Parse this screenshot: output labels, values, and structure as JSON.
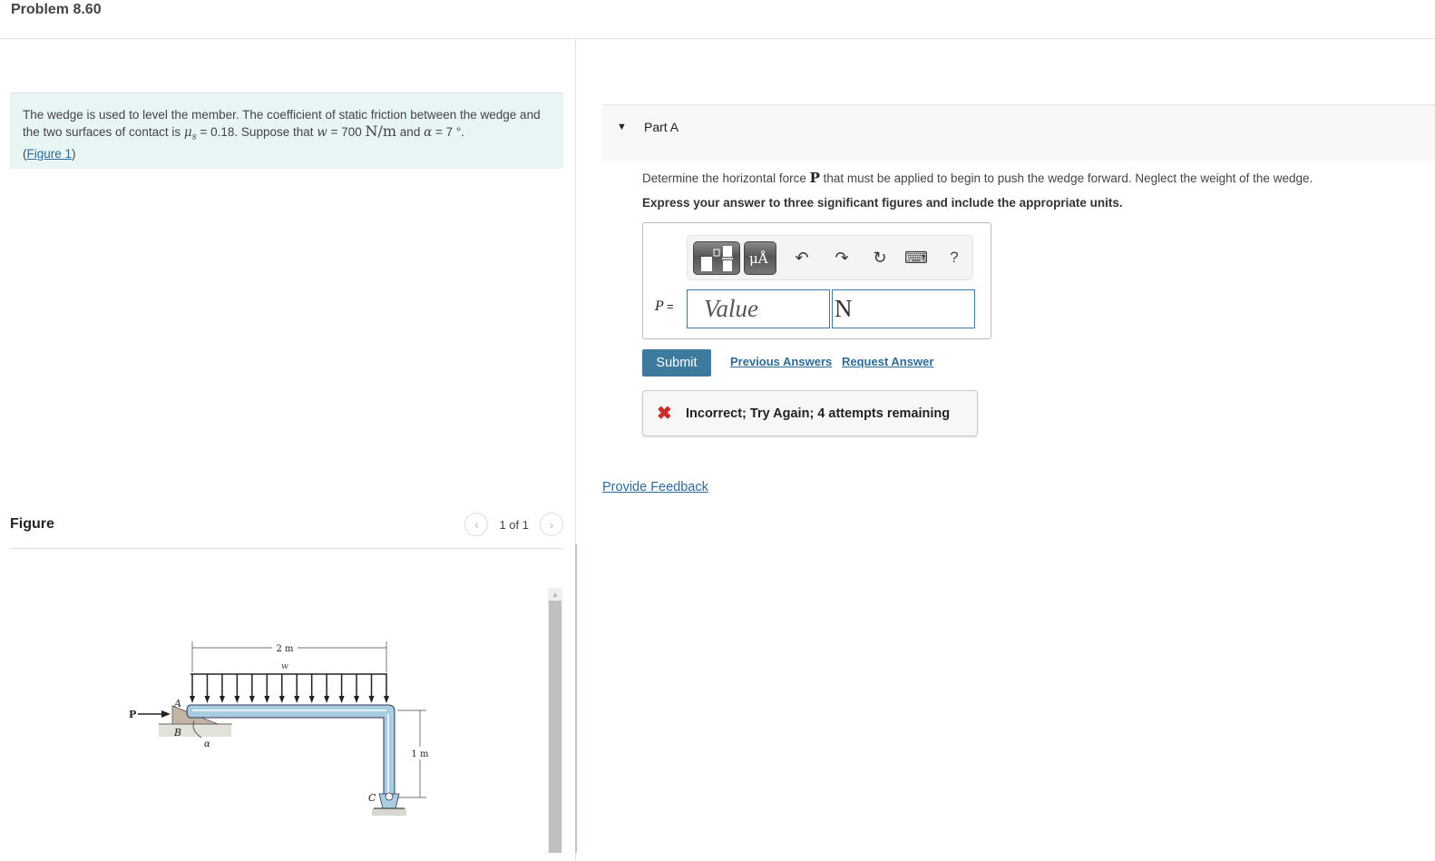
{
  "header": {
    "title": "Problem 8.60"
  },
  "intro": {
    "text1": "The wedge is used to level the member. The coefficient of static friction between the wedge and the two surfaces of contact is ",
    "mu_symbol": "μ",
    "mu_sub": "s",
    "text2": " = 0.18. Suppose that ",
    "w_symbol": "w",
    "text3": " = 700 ",
    "w_unit": "N/m",
    "text4": " and ",
    "alpha_symbol": "α",
    "text5": " = 7 °.",
    "figure_link_open": "(",
    "figure_link": "Figure 1",
    "figure_link_close": ")"
  },
  "figure": {
    "label": "Figure",
    "pager": {
      "prev_icon": "‹",
      "count": "1 of 1",
      "next_icon": "›"
    },
    "diagram": {
      "dim_top": "2 m",
      "load_label": "w",
      "dim_side": "1 m",
      "force_label": "P",
      "point_a": "A",
      "point_b": "B",
      "point_c": "C",
      "angle_label": "α"
    }
  },
  "part": {
    "caret": "▼",
    "label": "Part A",
    "question_pre": "Determine the horizontal force ",
    "question_var": "P",
    "question_post": " that must be applied to begin to push the wedge forward. Neglect the weight of the wedge.",
    "instruction": "Express your answer to three significant figures and include the appropriate units.",
    "toolbar": {
      "templates_icon": "templates-icon",
      "units_label": "μÅ",
      "undo": "↶",
      "redo": "↷",
      "reset": "↻",
      "keyboard": "⌨",
      "help": "?"
    },
    "answer_var": "P",
    "answer_eq": " =",
    "value_placeholder": "Value",
    "value": "",
    "unit_value": "N",
    "submit_label": "Submit",
    "previous_answers_label": "Previous Answers",
    "request_answer_label": "Request Answer",
    "feedback_icon": "✖",
    "feedback_message": "Incorrect; Try Again; 4 attempts remaining"
  },
  "provide_feedback_label": "Provide Feedback",
  "colors": {
    "accent": "#3d7a9e",
    "link": "#2d6a96",
    "error": "#c9302c",
    "intro_bg": "#e8f5f5"
  }
}
